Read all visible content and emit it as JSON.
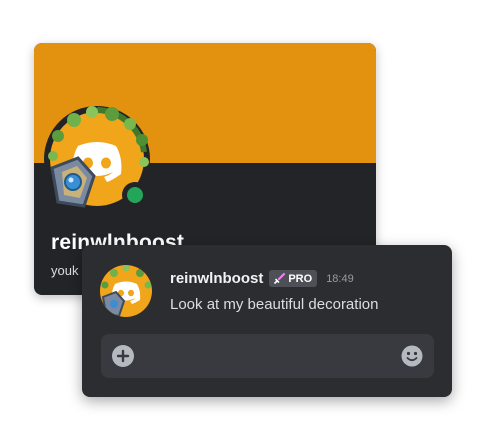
{
  "profile": {
    "display_name": "reinwlnboost",
    "username": "youk",
    "banner_color": "#e3920f",
    "status": "online",
    "status_color": "#23a55a",
    "avatar_icon": "discord-logo-icon",
    "avatar_decoration": "vine-shield-decoration"
  },
  "message": {
    "author": "reinwlnboost",
    "badge_icon": "sword-icon",
    "badge_label": "PRO",
    "timestamp": "18:49",
    "text": "Look at my beautiful decoration",
    "avatar_icon": "discord-logo-icon"
  },
  "composer": {
    "attach_icon": "plus-circle-icon",
    "emoji_icon": "smiley-icon"
  }
}
